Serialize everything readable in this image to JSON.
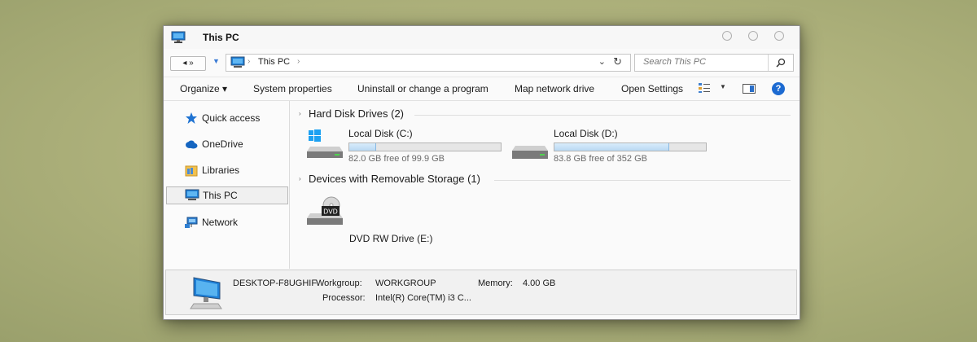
{
  "window": {
    "title": "This PC"
  },
  "navigation": {
    "back_forward": "◂ »",
    "address_path": "This PC",
    "search_placeholder": "Search This PC"
  },
  "toolbar": {
    "organize": "Organize ▾",
    "system_properties": "System properties",
    "uninstall": "Uninstall or change a program",
    "map_drive": "Map network drive",
    "open_settings": "Open Settings",
    "help": "?"
  },
  "sidebar": {
    "items": [
      {
        "label": "Quick access",
        "icon": "star-icon"
      },
      {
        "label": "OneDrive",
        "icon": "cloud-icon"
      },
      {
        "label": "Libraries",
        "icon": "libraries-icon"
      },
      {
        "label": "This PC",
        "icon": "computer-icon",
        "selected": true
      },
      {
        "label": "Network",
        "icon": "network-icon"
      }
    ]
  },
  "groups": {
    "hard_disks": {
      "title": "Hard Disk Drives (2)",
      "drives": [
        {
          "name": "Local Disk (C:)",
          "free": "82.0 GB free of 99.9 GB",
          "used_fraction": 0.18
        },
        {
          "name": "Local Disk (D:)",
          "free": "83.8 GB free of 352 GB",
          "used_fraction": 0.76
        }
      ]
    },
    "removable": {
      "title": "Devices with Removable Storage (1)",
      "drives": [
        {
          "name": "DVD RW Drive (E:)",
          "icon_text": "DVD"
        }
      ]
    }
  },
  "details": {
    "computer_name": "DESKTOP-F8UGHIF",
    "workgroup_label": "Workgroup:",
    "workgroup_value": "WORKGROUP",
    "memory_label": "Memory:",
    "memory_value": "4.00 GB",
    "processor_label": "Processor:",
    "processor_value": "Intel(R) Core(TM) i3 C..."
  },
  "colors": {
    "accent": "#1c6ad1",
    "drive_bar_fill": "#b9d9f3"
  }
}
